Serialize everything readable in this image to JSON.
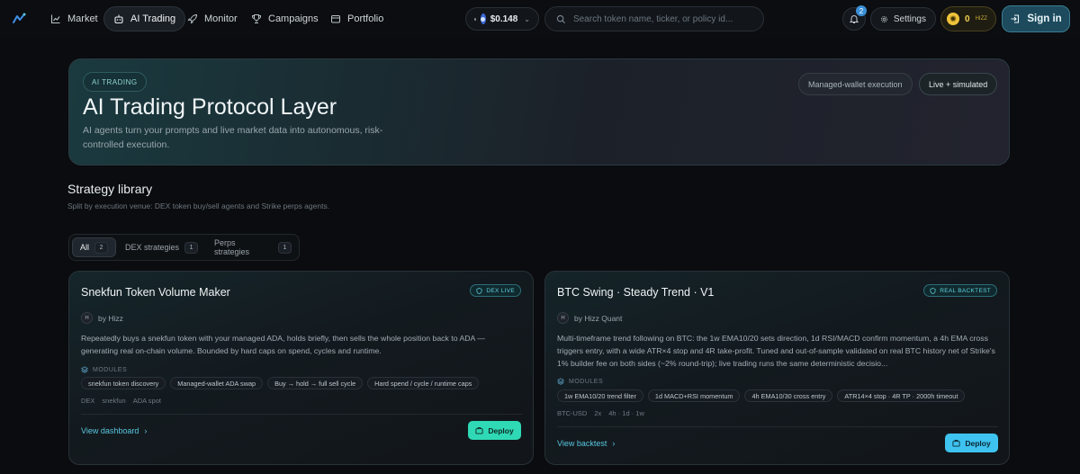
{
  "nav": {
    "items": [
      {
        "label": "Market",
        "icon": "chart-icon"
      },
      {
        "label": "AI Trading",
        "icon": "robot-icon"
      },
      {
        "label": "Monitor",
        "icon": "rocket-icon"
      },
      {
        "label": "Campaigns",
        "icon": "trophy-icon"
      },
      {
        "label": "Portfolio",
        "icon": "wallet-icon"
      }
    ],
    "active": "AI Trading",
    "price": "$0.148",
    "search_placeholder": "Search token name, ticker, or policy id...",
    "notification_count": "2",
    "settings_label": "Settings",
    "points_value": "0",
    "points_unit": "HIZZ",
    "signin_label": "Sign in"
  },
  "hero": {
    "tag": "AI TRADING",
    "title": "AI Trading Protocol Layer",
    "description": "AI agents turn your prompts and live market data into autonomous, risk-controlled execution.",
    "pill_1": "Managed-wallet execution",
    "pill_2": "Live + simulated"
  },
  "library": {
    "title": "Strategy library",
    "subtitle": "Split by execution venue: DEX token buy/sell agents and Strike perps agents.",
    "tabs": [
      {
        "label": "All",
        "count": "2"
      },
      {
        "label": "DEX strategies",
        "count": "1"
      },
      {
        "label": "Perps strategies",
        "count": "1"
      }
    ]
  },
  "cards": [
    {
      "title": "Snekfun Token Volume Maker",
      "badge": "DEX LIVE",
      "author_initial": "H",
      "author": "by Hizz",
      "description": "Repeatedly buys a snekfun token with your managed ADA, holds briefly, then sells the whole position back to ADA — generating real on-chain volume. Bounded by hard caps on spend, cycles and runtime.",
      "modules_label": "MODULES",
      "modules": [
        "snekfun token discovery",
        "Managed-wallet ADA swap",
        "Buy → hold → full sell cycle",
        "Hard spend / cycle / runtime caps"
      ],
      "tags": [
        "DEX",
        "snekfun",
        "ADA spot"
      ],
      "link": "View dashboard",
      "deploy": "Deploy"
    },
    {
      "title": "BTC Swing · Steady Trend · V1",
      "badge": "REAL BACKTEST",
      "author_initial": "H",
      "author": "by Hizz Quant",
      "description": "Multi-timeframe trend following on BTC: the 1w EMA10/20 sets direction, 1d RSI/MACD confirm momentum, a 4h EMA cross triggers entry, with a wide ATR×4 stop and 4R take-profit. Tuned and out-of-sample validated on real BTC history net of Strike's 1% builder fee on both sides (~2% round-trip); live trading runs the same deterministic decisio...",
      "modules_label": "MODULES",
      "modules": [
        "1w EMA10/20 trend filter",
        "1d MACD+RSI momentum",
        "4h EMA10/30 cross entry",
        "ATR14×4 stop · 4R TP · 2000h timeout"
      ],
      "tags": [
        "BTC-USD",
        "2x",
        "4h · 1d · 1w"
      ],
      "link": "View backtest",
      "deploy": "Deploy"
    }
  ]
}
